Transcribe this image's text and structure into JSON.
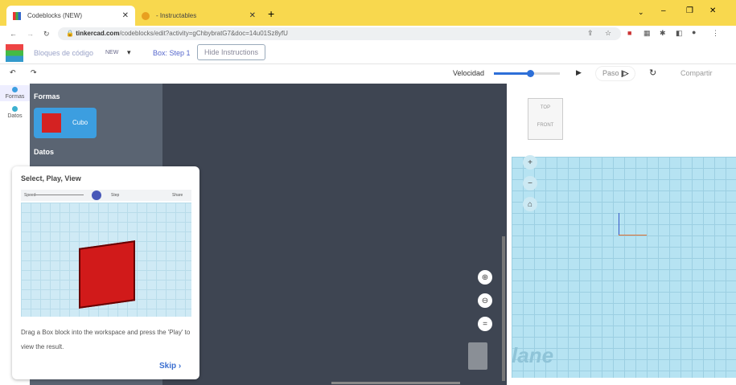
{
  "browser": {
    "tabs": [
      {
        "title": "Codeblocks (NEW)"
      },
      {
        "title": "- Instructables"
      }
    ],
    "url_host": "tinkercad.com",
    "url_path": "/codeblocks/edit?activity=gChbybratG7&doc=14u01Sz8yfU"
  },
  "header": {
    "app_name": "Bloques de código",
    "badge": "NEW",
    "step": "Box: Step 1",
    "hide_button": "Hide Instructions"
  },
  "toolbar": {
    "speed_label": "Velocidad",
    "speed_value": 0.55,
    "step_label": "Paso",
    "share_label": "Compartir"
  },
  "sidebar": {
    "items": [
      {
        "label": "Formas",
        "color": "#3c9ee0"
      },
      {
        "label": "Datos",
        "color": "#3cb0d0"
      }
    ]
  },
  "blocks": {
    "section1": "Formas",
    "block": "Cubo",
    "section2": "Datos"
  },
  "viewcube": {
    "top": "TOP",
    "front": "FRONT"
  },
  "workplane": "lane",
  "card": {
    "title": "Select, Play, View",
    "speed": "Speed",
    "step": "Step",
    "share": "Share",
    "text": "Drag a Box block into the workspace and press the 'Play' to view the result.",
    "skip": "Skip ›"
  }
}
